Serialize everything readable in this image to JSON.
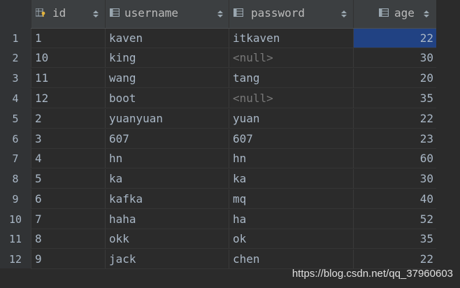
{
  "columns": [
    {
      "label": "id",
      "icon": "primary-key-column-icon"
    },
    {
      "label": "username",
      "icon": "column-icon"
    },
    {
      "label": "password",
      "icon": "column-icon"
    },
    {
      "label": "age",
      "icon": "column-icon"
    }
  ],
  "rows": [
    {
      "row_number": "1",
      "id": "1",
      "username": "kaven",
      "password": "itkaven",
      "age": "22"
    },
    {
      "row_number": "2",
      "id": "10",
      "username": "king",
      "password": "<null>",
      "age": "30"
    },
    {
      "row_number": "3",
      "id": "11",
      "username": "wang",
      "password": "tang",
      "age": "20"
    },
    {
      "row_number": "4",
      "id": "12",
      "username": "boot",
      "password": "<null>",
      "age": "35"
    },
    {
      "row_number": "5",
      "id": "2",
      "username": "yuanyuan",
      "password": "yuan",
      "age": "22"
    },
    {
      "row_number": "6",
      "id": "3",
      "username": "607",
      "password": "607",
      "age": "23"
    },
    {
      "row_number": "7",
      "id": "4",
      "username": "hn",
      "password": "hn",
      "age": "60"
    },
    {
      "row_number": "8",
      "id": "5",
      "username": "ka",
      "password": "ka",
      "age": "30"
    },
    {
      "row_number": "9",
      "id": "6",
      "username": "kafka",
      "password": "mq",
      "age": "40"
    },
    {
      "row_number": "10",
      "id": "7",
      "username": "haha",
      "password": "ha",
      "age": "52"
    },
    {
      "row_number": "11",
      "id": "8",
      "username": "okk",
      "password": "ok",
      "age": "35"
    },
    {
      "row_number": "12",
      "id": "9",
      "username": "jack",
      "password": "chen",
      "age": "22"
    }
  ],
  "selected_cell": {
    "row": 1,
    "column": "age"
  },
  "watermark": "https://blog.csdn.net/qq_37960603",
  "colors": {
    "background": "#2b2b2b",
    "header_background": "#3c3f41",
    "text": "#a9b7c6",
    "null_text": "#787878",
    "selection": "#214283"
  }
}
